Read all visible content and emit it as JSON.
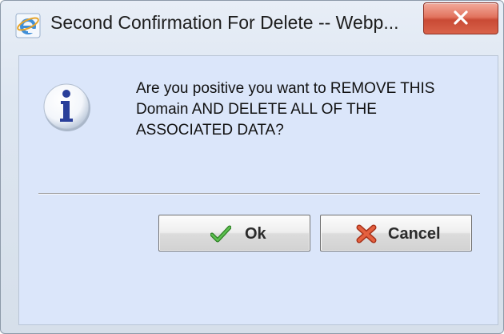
{
  "window": {
    "title": "Second Confirmation For Delete -- Webp...",
    "app_icon": "internet-explorer-icon",
    "close_icon": "close-icon"
  },
  "dialog": {
    "message": "Are you positive you want to REMOVE THIS Domain AND DELETE ALL OF THE ASSOCIATED DATA?",
    "message_icon": "info-icon"
  },
  "buttons": {
    "ok_label": "Ok",
    "ok_icon": "checkmark-icon",
    "cancel_label": "Cancel",
    "cancel_icon": "red-x-icon"
  },
  "colors": {
    "client_background": "#dbe6fa",
    "close_button": "#d9624a",
    "ok_check": "#3a9a2f",
    "cancel_x": "#d64a2b",
    "info_icon": "#2a3f9a"
  }
}
